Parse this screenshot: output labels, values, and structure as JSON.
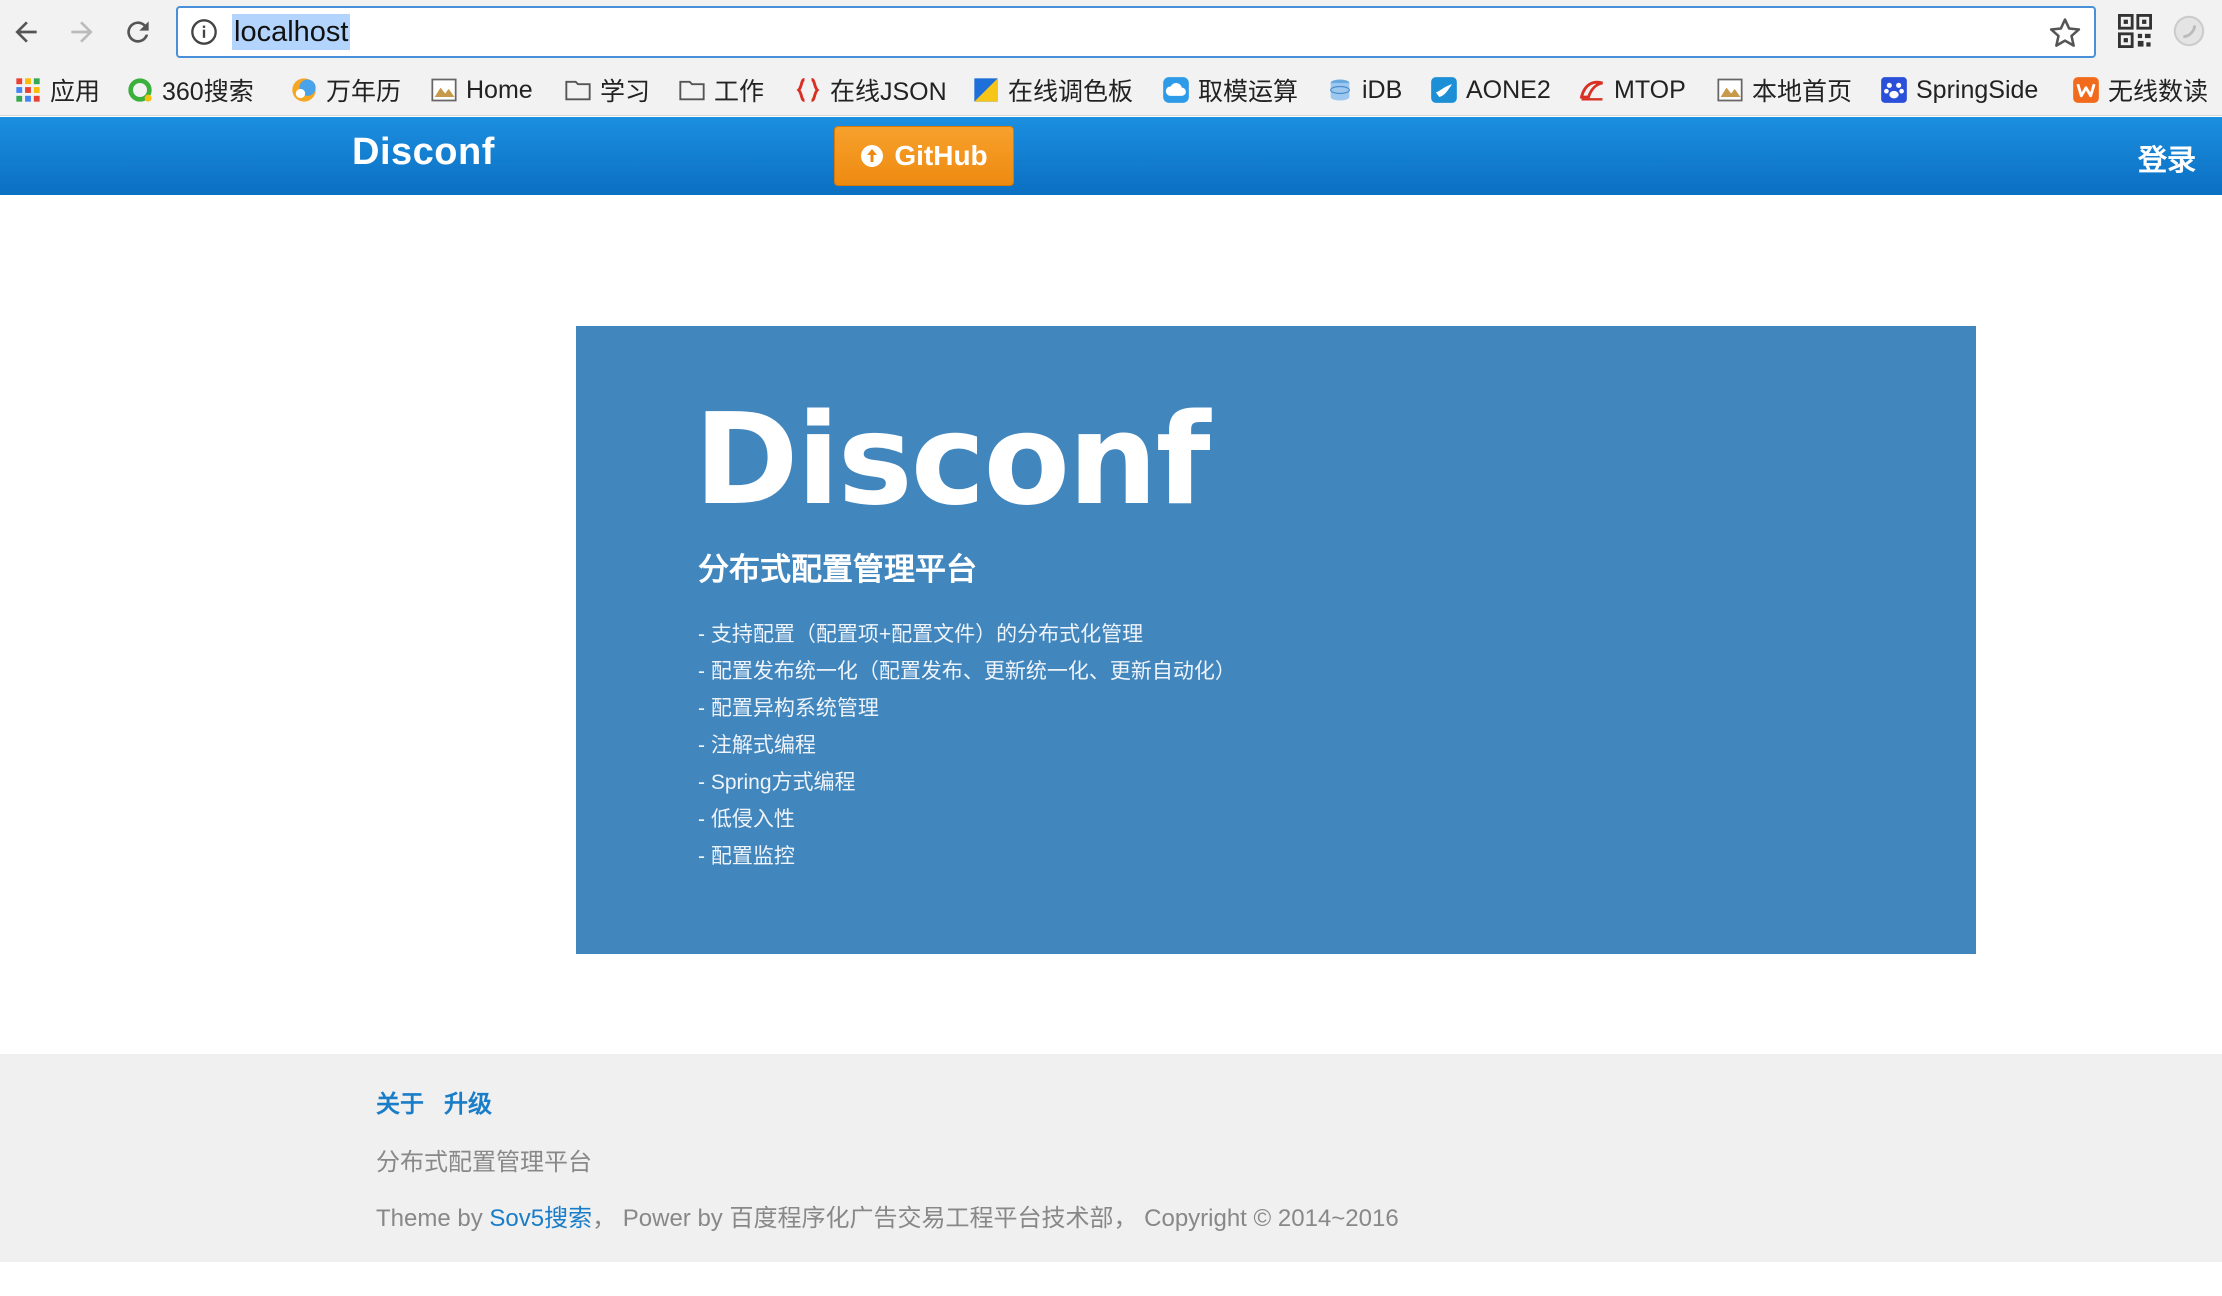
{
  "browser": {
    "url": "localhost",
    "bookmarks": [
      {
        "label": "应用",
        "icon": "apps-grid-icon"
      },
      {
        "label": "360搜索",
        "icon": "360-search-icon"
      },
      {
        "label": "万年历",
        "icon": "calendar-icon"
      },
      {
        "label": "Home",
        "icon": "page-icon"
      },
      {
        "label": "学习",
        "icon": "folder-icon"
      },
      {
        "label": "工作",
        "icon": "folder-icon"
      },
      {
        "label": "在线JSON",
        "icon": "json-braces-icon"
      },
      {
        "label": "在线调色板",
        "icon": "palette-icon"
      },
      {
        "label": "取模运算",
        "icon": "cloud-icon"
      },
      {
        "label": "iDB",
        "icon": "database-icon"
      },
      {
        "label": "AONE2",
        "icon": "bird-icon"
      },
      {
        "label": "MTOP",
        "icon": "mtop-icon"
      },
      {
        "label": "本地首页",
        "icon": "page-icon"
      },
      {
        "label": "SpringSide",
        "icon": "paw-icon"
      },
      {
        "label": "无线数读",
        "icon": "w-logo-icon"
      }
    ]
  },
  "navbar": {
    "brand": "Disconf",
    "github_label": "GitHub",
    "login_label": "登录"
  },
  "banner": {
    "title": "Disconf",
    "subtitle": "分布式配置管理平台",
    "features": [
      "- 支持配置（配置项+配置文件）的分布式化管理",
      "- 配置发布统一化（配置发布、更新统一化、更新自动化）",
      "- 配置异构系统管理",
      "- 注解式编程",
      "- Spring方式编程",
      "- 低侵入性",
      "- 配置监控"
    ]
  },
  "footer": {
    "links": [
      "关于",
      "升级"
    ],
    "tagline": "分布式配置管理平台",
    "theme_prefix": "Theme by ",
    "theme_link": "Sov5搜索",
    "copyright_rest": "，  Power by 百度程序化广告交易工程平台技术部，  Copyright © 2014~2016"
  },
  "colors": {
    "navbar": "#0b6fc2",
    "github_button": "#ee8a10",
    "banner": "#4286be",
    "footer_bg": "#f0f0f0",
    "link": "#1a7dc8"
  }
}
